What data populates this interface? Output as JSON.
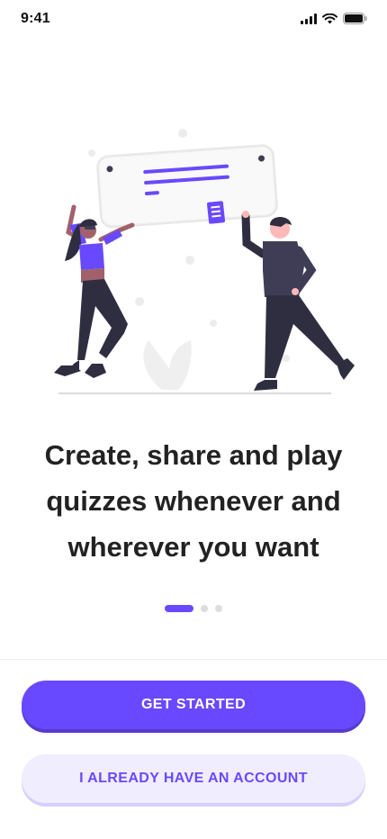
{
  "status_bar": {
    "time": "9:41"
  },
  "onboarding": {
    "headline": "Create, share and play quizzes whenever and wherever you want",
    "page_indicator": {
      "total": 3,
      "active": 1
    }
  },
  "actions": {
    "primary_label": "GET STARTED",
    "secondary_label": "I ALREADY HAVE AN ACCOUNT"
  },
  "colors": {
    "accent": "#6949ff",
    "accent_light": "#f0edff",
    "text": "#222222"
  },
  "icons": [
    "cellular-signal-icon",
    "wifi-icon",
    "battery-icon"
  ]
}
